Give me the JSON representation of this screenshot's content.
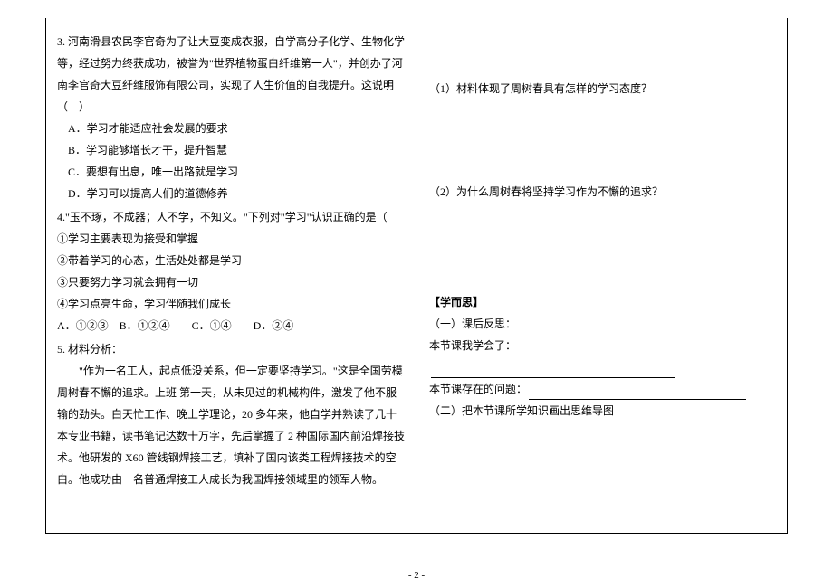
{
  "left": {
    "q3": {
      "stem": "3. 河南滑县农民李官奇为了让大豆变成衣服，自学高分子化学、生物化学等，经过努力终获成功，被誉为\"世界植物蛋白纤维第一人\"，并创办了河南李官奇大豆纤维服饰有限公司，实现了人生价值的自我提升。这说明（　）",
      "a": "A．学习才能适应社会发展的要求",
      "b": "B．学习能够增长才干，提升智慧",
      "c": "C．要想有出息，唯一出路就是学习",
      "d": "D．学习可以提高人们的道德修养"
    },
    "q4": {
      "stem": "4.\"玉不琢，不成器；人不学，不知义。\"下列对\"学习\"认识正确的是（",
      "s1": "①学习主要表现为接受和掌握",
      "s2": "②带着学习的心态，生活处处都是学习",
      "s3": "③只要努力学习就会拥有一切",
      "s4": "④学习点亮生命，学习伴随我们成长",
      "opts": "A．①②③　B．①②④　　C．①④　　D．②④"
    },
    "q5": {
      "title": "5. 材料分析：",
      "body": "　　\"作为一名工人，起点低没关系，但一定要坚持学习。\"这是全国劳模周树春不懈的追求。上班 第一天，从未见过的机械构件，激发了他不服输的劲头。白天忙工作、晚上学理论，20 多年来，他自学并熟读了几十本专业书籍，读书笔记达数十万字，先后掌握了 2 种国际国内前沿焊接技术。他研发的 X60 管线钢焊接工艺，填补了国内该类工程焊接技术的空白。他成功由一名普通焊接工人成长为我国焊接领域里的领军人物。"
    }
  },
  "right": {
    "q1": "（1）材料体现了周树春具有怎样的学习态度？",
    "q2": "（2）为什么周树春将坚持学习作为不懈的追求？",
    "xueersi_head": "【学而思】",
    "reflect_head": "（一）课后反思：",
    "learned_label": "本节课我学会了：",
    "problem_label": "本节课存在的问题：",
    "mindmap": "（二）把本节课所学知识画出思维导图"
  },
  "footer": "- 2 -"
}
